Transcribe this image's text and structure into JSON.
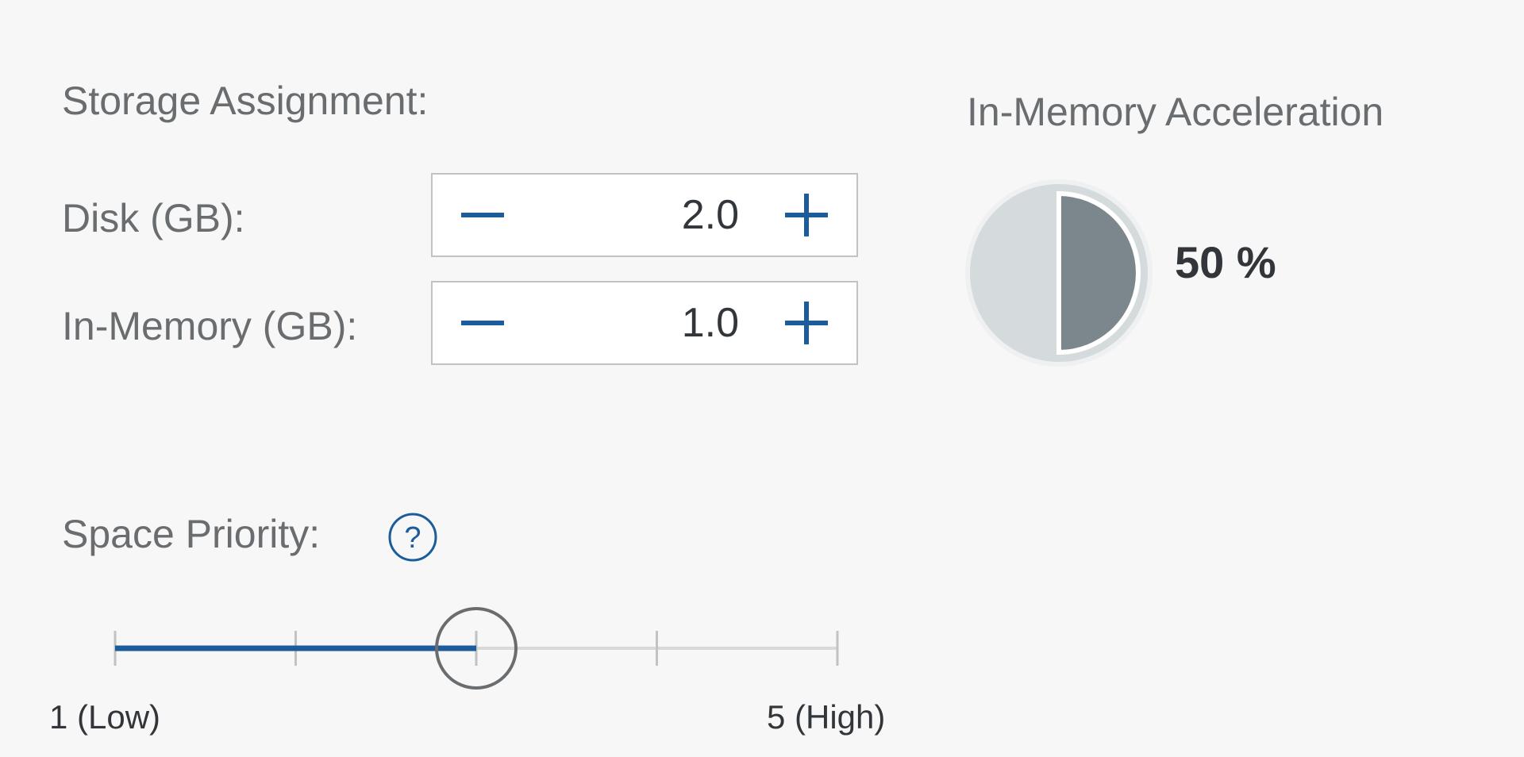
{
  "storage": {
    "title": "Storage Assignment:",
    "disk": {
      "label": "Disk (GB):",
      "value": "2.0"
    },
    "in_memory": {
      "label": "In-Memory (GB):",
      "value": "1.0"
    }
  },
  "acceleration": {
    "title": "In-Memory Acceleration",
    "value_text": "50 %",
    "fraction": 0.5,
    "colors": {
      "track": "#d5dadd",
      "fill": "#7c868d",
      "ring": "#eef0f1"
    }
  },
  "priority": {
    "label": "Space Priority:",
    "help_icon": "question-circle-icon",
    "min": 1,
    "max": 5,
    "value": 3,
    "min_label": "1 (Low)",
    "max_label": "5 (High)"
  },
  "icons": {
    "minus": "minus-icon",
    "plus": "plus-icon"
  },
  "colors": {
    "accent": "#1d5c9a",
    "track": "#d9d9d9",
    "handle": "#6a6d70"
  }
}
